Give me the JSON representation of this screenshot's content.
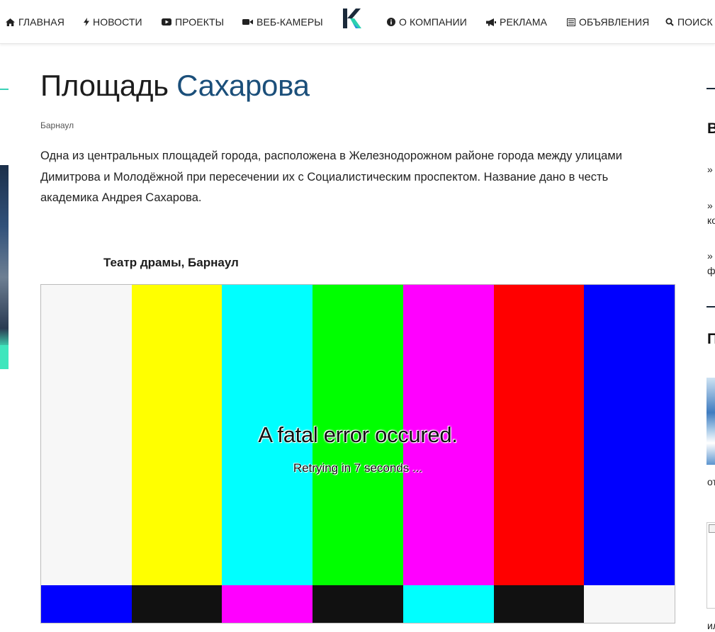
{
  "nav": {
    "items": [
      {
        "label": "Главная",
        "icon": "home-icon"
      },
      {
        "label": "Новости",
        "icon": "bolt-icon"
      },
      {
        "label": "Проекты",
        "icon": "youtube-icon"
      },
      {
        "label": "Веб-камеры",
        "icon": "video-camera-icon"
      },
      {
        "label": "О компании",
        "icon": "info-circle-icon"
      },
      {
        "label": "Реклама",
        "icon": "bullhorn-icon"
      },
      {
        "label": "Объявления",
        "icon": "list-alt-icon"
      },
      {
        "label": "Поиск",
        "icon": "search-icon"
      }
    ],
    "logo_letter": "K",
    "colors": {
      "logo_dark": "#1b2a3a",
      "logo_accent": "#2bd0b0"
    }
  },
  "main": {
    "title_part1": "Площадь",
    "title_part2": "Сахарова",
    "city": "Барнаул",
    "description": "Одна из центральных площадей города, расположена в Железнодорожном районе города между улицами Димитрова и Молодёжной при пересечении их с Социалистическим проспектом. Название дано в честь академика Андрея Сахарова.",
    "camera_title": "Театр драмы, Барнаул",
    "player": {
      "error_title": "A fatal error occured.",
      "error_retry": "Retrying in 7 seconds ..."
    },
    "colors": {
      "title_highlight": "#1b4f7a",
      "accent": "#3bd1b7"
    }
  },
  "sidebar_right": {
    "head1": "В",
    "links": [
      {
        "line1": "»"
      },
      {
        "line1": "»",
        "line2": "ко"
      },
      {
        "line1": "»",
        "line2": "ф"
      }
    ],
    "head2": "П",
    "card1_caption": "от",
    "card2_caption": "ил"
  },
  "bars": {
    "top": [
      "#f7f7f7",
      "#ffff00",
      "#00ffff",
      "#00ff00",
      "#ff00ff",
      "#ff0000",
      "#0000ff"
    ],
    "bottom": [
      "#0000ff",
      "#111111",
      "#ff00ff",
      "#111111",
      "#00ffff",
      "#111111",
      "#f7f7f7"
    ]
  }
}
